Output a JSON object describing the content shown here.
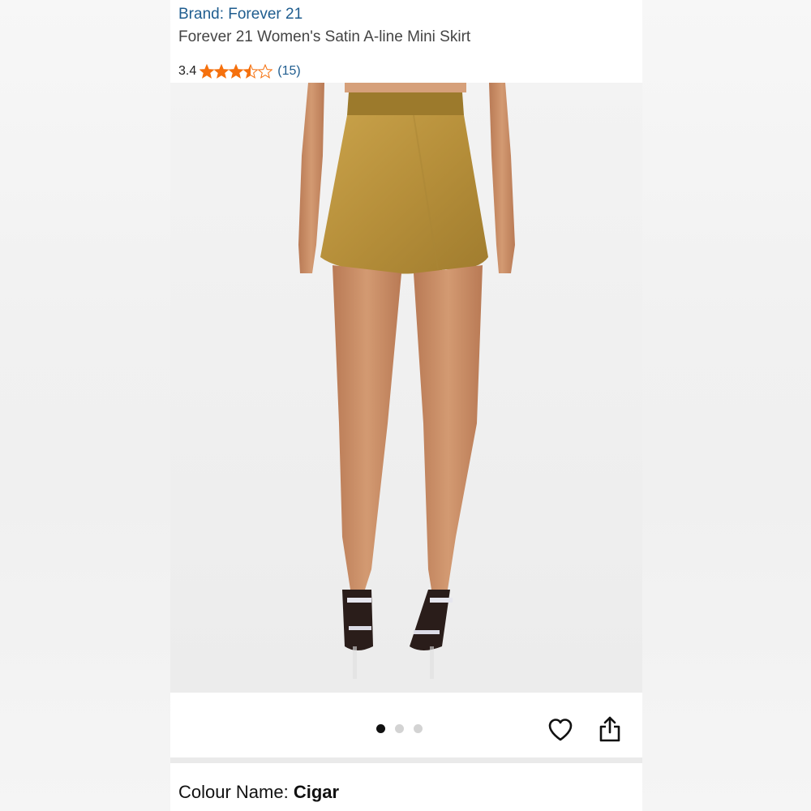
{
  "header": {
    "brand": "Brand: Forever 21",
    "title": "Forever 21 Women's Satin A-line Mini Skirt"
  },
  "rating": {
    "value": "3.4",
    "stars": 3.4,
    "review_count": "(15)",
    "star_color": "#f5700d"
  },
  "gallery": {
    "image_alt": "Forever 21 Women's Satin A-line Mini Skirt",
    "dots": [
      {
        "active": true
      },
      {
        "active": false
      },
      {
        "active": false
      }
    ],
    "wishlist_icon": "heart-icon",
    "share_icon": "share-icon"
  },
  "colour": {
    "label": "Colour Name:",
    "value": "Cigar"
  },
  "colors": {
    "link": "#1f5d8f",
    "skirt": "#b9943e"
  }
}
